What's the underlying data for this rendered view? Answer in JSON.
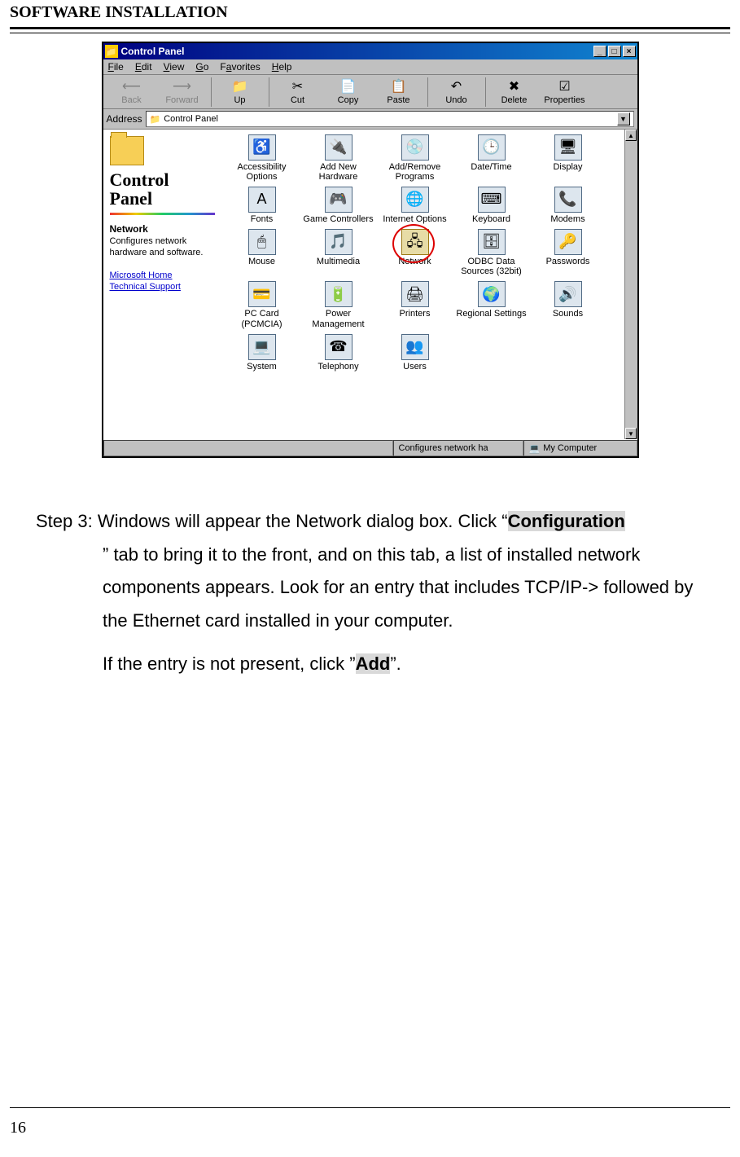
{
  "page": {
    "header": "SOFTWARE INSTALLATION",
    "number": "16"
  },
  "win": {
    "title": "Control Panel",
    "min": "_",
    "max": "□",
    "close": "×",
    "menu": {
      "file": "File",
      "edit": "Edit",
      "view": "View",
      "go": "Go",
      "fav": "Favorites",
      "help": "Help"
    },
    "tb": {
      "back": "Back",
      "forward": "Forward",
      "up": "Up",
      "cut": "Cut",
      "copy": "Copy",
      "paste": "Paste",
      "undo": "Undo",
      "delete": "Delete",
      "props": "Properties"
    },
    "addr": {
      "label": "Address",
      "value": "Control Panel"
    },
    "left": {
      "title": "Control Panel",
      "subtitle": "Network",
      "desc": "Configures network hardware and software.",
      "link1": "Microsoft Home",
      "link2": "Technical Support"
    },
    "icons": {
      "access": "Accessibility Options",
      "addhw": "Add New Hardware",
      "addrem": "Add/Remove Programs",
      "datetime": "Date/Time",
      "display": "Display",
      "fonts": "Fonts",
      "game": "Game Controllers",
      "inet": "Internet Options",
      "keyboard": "Keyboard",
      "modems": "Modems",
      "mouse": "Mouse",
      "mm": "Multimedia",
      "network": "Network",
      "odbc": "ODBC Data Sources (32bit)",
      "passwords": "Passwords",
      "pccard": "PC Card (PCMCIA)",
      "power": "Power Management",
      "printers": "Printers",
      "regional": "Regional Settings",
      "sounds": "Sounds",
      "system": "System",
      "telephony": "Telephony",
      "users": "Users"
    },
    "status": {
      "left": "",
      "mid": "Configures network ha",
      "right": "My Computer"
    }
  },
  "text": {
    "step_label": "Step 3: ",
    "step_first": "Windows will appear the Network dialog box. Click “",
    "conf": "Configuration",
    "step_after_conf": "” tab to bring it to the front, and on this tab, a list of installed network components appears. Look for an entry that includes TCP/IP-> followed by the Ethernet card installed in your computer.",
    "step2_pre": "If the entry is not present, click ”",
    "add": "Add",
    "step2_post": "”."
  }
}
